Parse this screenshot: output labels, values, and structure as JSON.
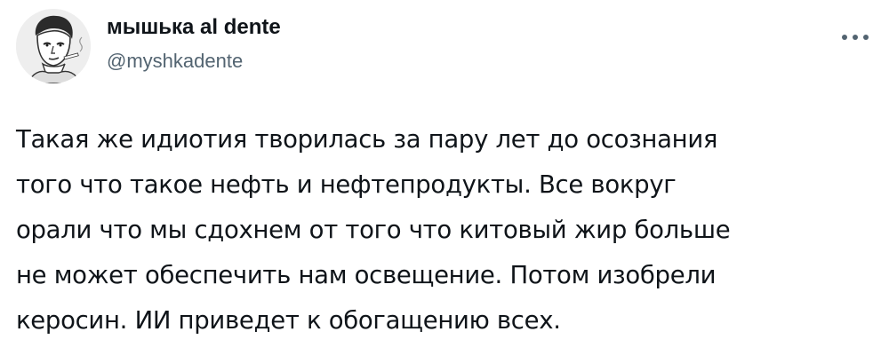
{
  "author": {
    "display_name": "мышька al dente",
    "handle": "@myshkadente"
  },
  "tweet": {
    "lines": [
      "Такая же идиотия творилась за пару лет до осознания",
      "того что такое нефть и нефтепродукты. Все вокруг",
      "орали что мы сдохнем от того что китовый жир больше",
      "не может обеспечить нам освещение. Потом изобрели",
      "керосин. ИИ приведет к обогащению всех."
    ]
  },
  "icons": {
    "more": "more-horizontal-icon",
    "avatar": "sketched-portrait"
  },
  "colors": {
    "text": "#0f1419",
    "secondary": "#536471"
  }
}
